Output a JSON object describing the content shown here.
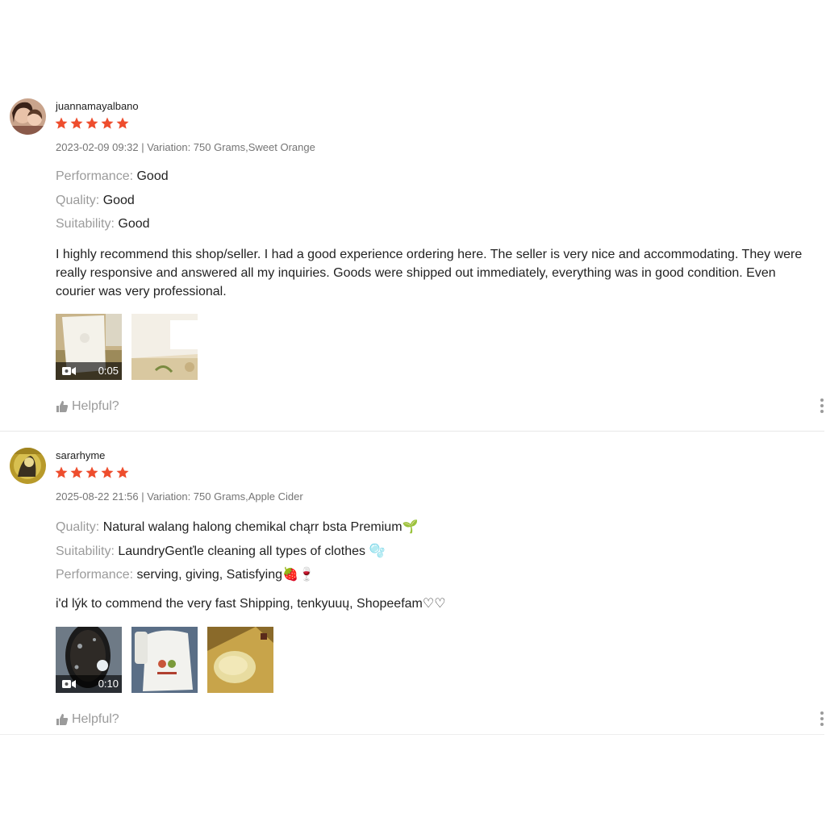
{
  "colors": {
    "star": "#ee4d2d",
    "label": "#9b9b9b",
    "meta": "#757575",
    "text": "#222222"
  },
  "reviews": [
    {
      "username": "juannamayalbano",
      "rating": 5,
      "meta": "2023-02-09 09:32 | Variation: 750 Grams,Sweet Orange",
      "attributes": [
        {
          "label": "Performance: ",
          "value": "Good"
        },
        {
          "label": "Quality: ",
          "value": "Good"
        },
        {
          "label": "Suitability: ",
          "value": "Good"
        }
      ],
      "comment": "I highly recommend this shop/seller. I had a good experience ordering here. The seller is very nice and accommodating. They were really responsive and answered all my inquiries. Goods were shipped out immediately, everything was in good condition. Even courier was very professional.",
      "media": [
        {
          "type": "video",
          "duration": "0:05"
        },
        {
          "type": "image"
        }
      ],
      "helpful_label": "Helpful?"
    },
    {
      "username": "sararhyme",
      "rating": 5,
      "meta": "2025-08-22 21:56 | Variation: 750 Grams,Apple Cider",
      "attributes": [
        {
          "label": "Quality: ",
          "value": "Natural walang halong chemikal chąrr bsta Premium🌱"
        },
        {
          "label": "Suitability: ",
          "value": "LaundryGenťle cleaning all types of clothes 🫧"
        },
        {
          "label": "Performance: ",
          "value": "serving, giving, Satisfying🍓🍷"
        }
      ],
      "comment": "i'd lýk to commend the very fast Shipping, tenkyuuų, Shopeefam♡♡",
      "media": [
        {
          "type": "video",
          "duration": "0:10"
        },
        {
          "type": "image"
        },
        {
          "type": "image"
        }
      ],
      "helpful_label": "Helpful?"
    }
  ]
}
